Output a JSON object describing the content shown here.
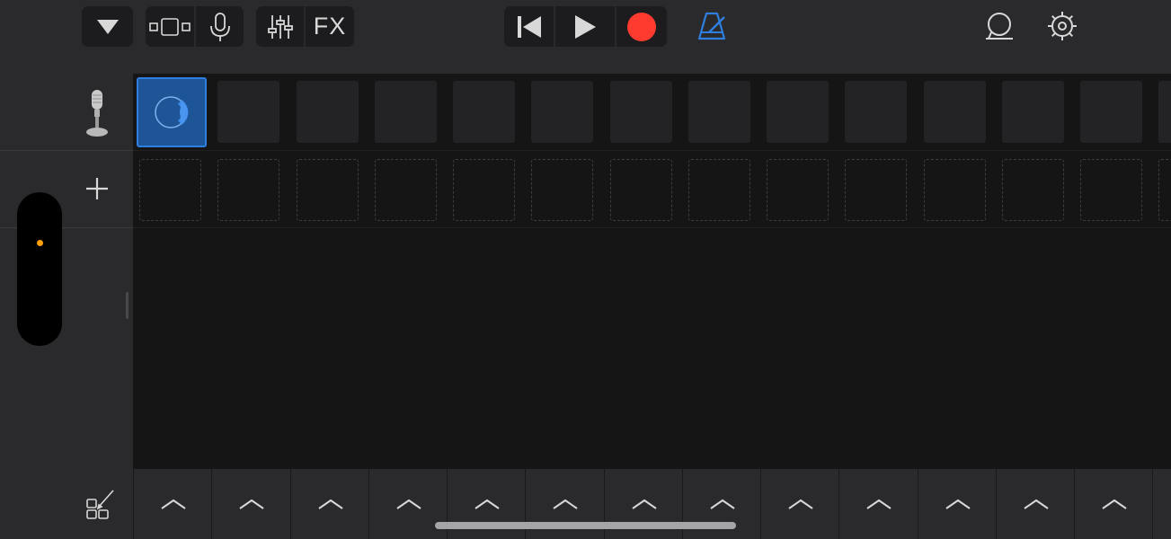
{
  "toolbar": {
    "menu_icon": "triangle-down-icon",
    "view_icon": "tracks-view-icon",
    "mic_icon": "microphone-icon",
    "mixer_icon": "sliders-icon",
    "fx_label": "FX",
    "rewind_icon": "rewind-icon",
    "play_icon": "play-icon",
    "record_icon": "record-icon",
    "metronome_icon": "metronome-icon",
    "loop_icon": "loop-icon",
    "settings_icon": "gear-icon"
  },
  "colors": {
    "record": "#ff3b30",
    "accent": "#2f7fe0",
    "selected_cell": "#1d5597",
    "level_dot": "#ff9f0a"
  },
  "tracks": [
    {
      "icon": "microphone-icon"
    },
    {
      "icon": "plus-icon"
    }
  ],
  "grid": {
    "columns": 13,
    "rows": [
      {
        "type": "filled",
        "selected_index": 0
      },
      {
        "type": "empty"
      }
    ]
  },
  "bottom": {
    "edit_icon": "edit-cells-icon",
    "trigger_icon": "chevron-up-icon"
  }
}
